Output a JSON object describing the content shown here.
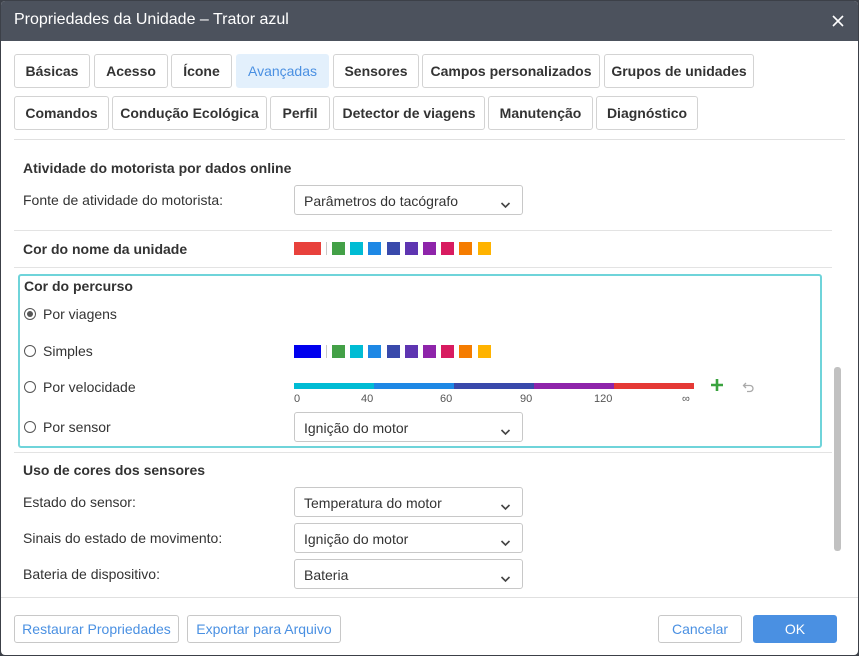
{
  "window": {
    "title": "Propriedades da Unidade – Trator azul",
    "close_icon": "close-icon"
  },
  "tabs_row1": [
    {
      "label": "Básicas"
    },
    {
      "label": "Acesso"
    },
    {
      "label": "Ícone"
    },
    {
      "label": "Avançadas",
      "active": true
    },
    {
      "label": "Sensores"
    },
    {
      "label": "Campos personalizados"
    },
    {
      "label": "Grupos de unidades"
    }
  ],
  "tabs_row2": [
    {
      "label": "Comandos"
    },
    {
      "label": "Condução Ecológica"
    },
    {
      "label": "Perfil"
    },
    {
      "label": "Detector de viagens"
    },
    {
      "label": "Manutenção"
    },
    {
      "label": "Diagnóstico"
    }
  ],
  "driver_activity": {
    "heading": "Atividade do motorista por dados online",
    "source_label": "Fonte de atividade do motorista:",
    "source_value": "Parâmetros do tacógrafo"
  },
  "unit_name_color": {
    "heading": "Cor do nome da unidade",
    "selected_color": "#e8413c"
  },
  "palette": [
    "#43a047",
    "#00bcd4",
    "#1e88e5",
    "#3949ab",
    "#5e35b1",
    "#8e24aa",
    "#d81b60",
    "#f57c00",
    "#ffb300"
  ],
  "route_color": {
    "heading": "Cor do percurso",
    "by_trips": "Por viagens",
    "simple": "Simples",
    "simple_color": "#0000ee",
    "by_speed": "Por velocidade",
    "by_sensor": "Por sensor",
    "sensor_value": "Ignição do motor",
    "selected_option": "by_trips",
    "speed_ticks": [
      "0",
      "40",
      "60",
      "90",
      "120",
      "∞"
    ],
    "speed_colors": [
      "#00bcd4",
      "#1e88e5",
      "#3949ab",
      "#8e24aa",
      "#e53935"
    ],
    "add_icon": "plus-icon",
    "undo_icon": "undo-icon"
  },
  "sensor_colors": {
    "heading": "Uso de cores dos sensores",
    "state_label": "Estado do sensor:",
    "state_value": "Temperatura do motor",
    "movement_label": "Sinais do estado de movimento:",
    "movement_value": "Ignição do motor",
    "battery_label": "Bateria de dispositivo:",
    "battery_value": "Bateria"
  },
  "footer": {
    "restore": "Restaurar Propriedades",
    "export": "Exportar para Arquivo",
    "cancel": "Cancelar",
    "ok": "OK"
  },
  "colors": {
    "accent": "#4a90e2",
    "titlebar": "#4c525d",
    "highlight_border": "#6fd4da"
  }
}
